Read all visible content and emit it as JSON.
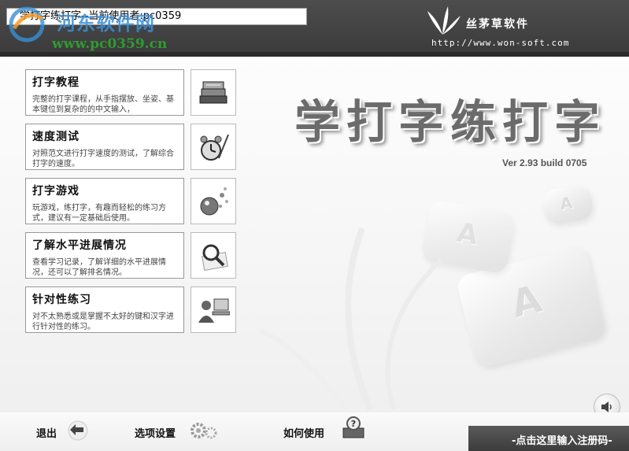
{
  "window": {
    "title": "学打字练打字--当前使用者:pc0359"
  },
  "watermark": {
    "site_name": "河东软件网",
    "url": "www.pc0359.cn"
  },
  "brand": {
    "name": "丝茅草软件",
    "url": "http://www.won-soft.com"
  },
  "main": {
    "title": "学打字练打字",
    "version": "Ver 2.93 build 0705",
    "key_letter": "A"
  },
  "menu": [
    {
      "title": "打字教程",
      "desc": "完整的打字课程，从手指摆放、坐姿、基本键位到复杂的的中文输入，",
      "icon": "books-icon"
    },
    {
      "title": "速度测试",
      "desc": "对照范文进行打字速度的测试，了解综合打字的速度。",
      "icon": "alarm-clock-icon"
    },
    {
      "title": "打字游戏",
      "desc": "玩游戏，练打字，有趣而轻松的练习方式，建议有一定基础后使用。",
      "icon": "game-icon"
    },
    {
      "title": "了解水平进展情况",
      "desc": "查看学习记录，了解详细的水平进展情况，还可以了解排名情况。",
      "icon": "magnifier-icon"
    },
    {
      "title": "针对性练习",
      "desc": "对不太熟悉或是掌握不太好的键和汉字进行针对性的练习。",
      "icon": "user-computer-icon"
    }
  ],
  "bottom": {
    "exit": "退出",
    "options": "选项设置",
    "help": "如何使用",
    "register": "-点击这里输入注册码-"
  },
  "colors": {
    "header": "#3f3f3f",
    "title_gray": "#6b6b6b",
    "watermark_blue": "#3a8fd6",
    "watermark_green": "#2f9a2f"
  }
}
